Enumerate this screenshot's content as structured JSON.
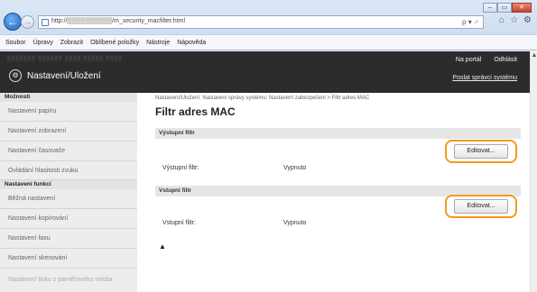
{
  "browser": {
    "address": "http://▒▒▒▒▒▒▒▒▒▒/m_security_macfilter.html",
    "address_controls": "ρ ▾ ♂",
    "window_buttons": [
      "‒",
      "▭",
      "✕"
    ],
    "menu": [
      "Soubor",
      "Úpravy",
      "Zobrazit",
      "Oblíbené položky",
      "Nástroje",
      "Nápověda"
    ],
    "toolbar_icons": [
      "home-icon",
      "star-icon",
      "gear-icon"
    ]
  },
  "header": {
    "blurred_text": "▒▒▒▒▒▒▒ ▒▒▒▒▒▒ ▒▒▒▒ ▒▒▒▒▒ ▒▒▒▒",
    "title": "Nastavení/Uložení",
    "links": [
      "Na portál",
      "Odhlásit"
    ],
    "admin_link": "Poslat správci systému"
  },
  "sidebar": {
    "section1": "Možnosti",
    "items1": [
      "Nastavení papíru",
      "Nastavení zobrazení",
      "Nastavení časovače",
      "Ovládání hlasitosti zvuku"
    ],
    "section2": "Nastavení funkcí",
    "items2": [
      "Běžná nastavení",
      "Nastavení kopírování",
      "Nastavení faxu",
      "Nastavení skenování",
      "Nastavení tisku z paměťového média"
    ]
  },
  "main": {
    "breadcrumb": "Nastavení/Uložení: Nastavení správy systému: Nastavení zabezpečení > Filtr adres MAC",
    "title": "Filtr adres MAC",
    "outbound": {
      "section": "Výstupní filtr",
      "edit_label": "Editovat...",
      "field_label": "Výstupní filtr:",
      "value": "Vypnuto"
    },
    "inbound": {
      "section": "Vstupní filtr",
      "edit_label": "Editovat...",
      "field_label": "Vstupní filtr:",
      "value": "Vypnuto"
    },
    "top_arrow": "▲"
  },
  "colors": {
    "header_bg": "#2c2c2c",
    "highlight": "#f29a1d",
    "sidebar_bg": "#ededed"
  }
}
